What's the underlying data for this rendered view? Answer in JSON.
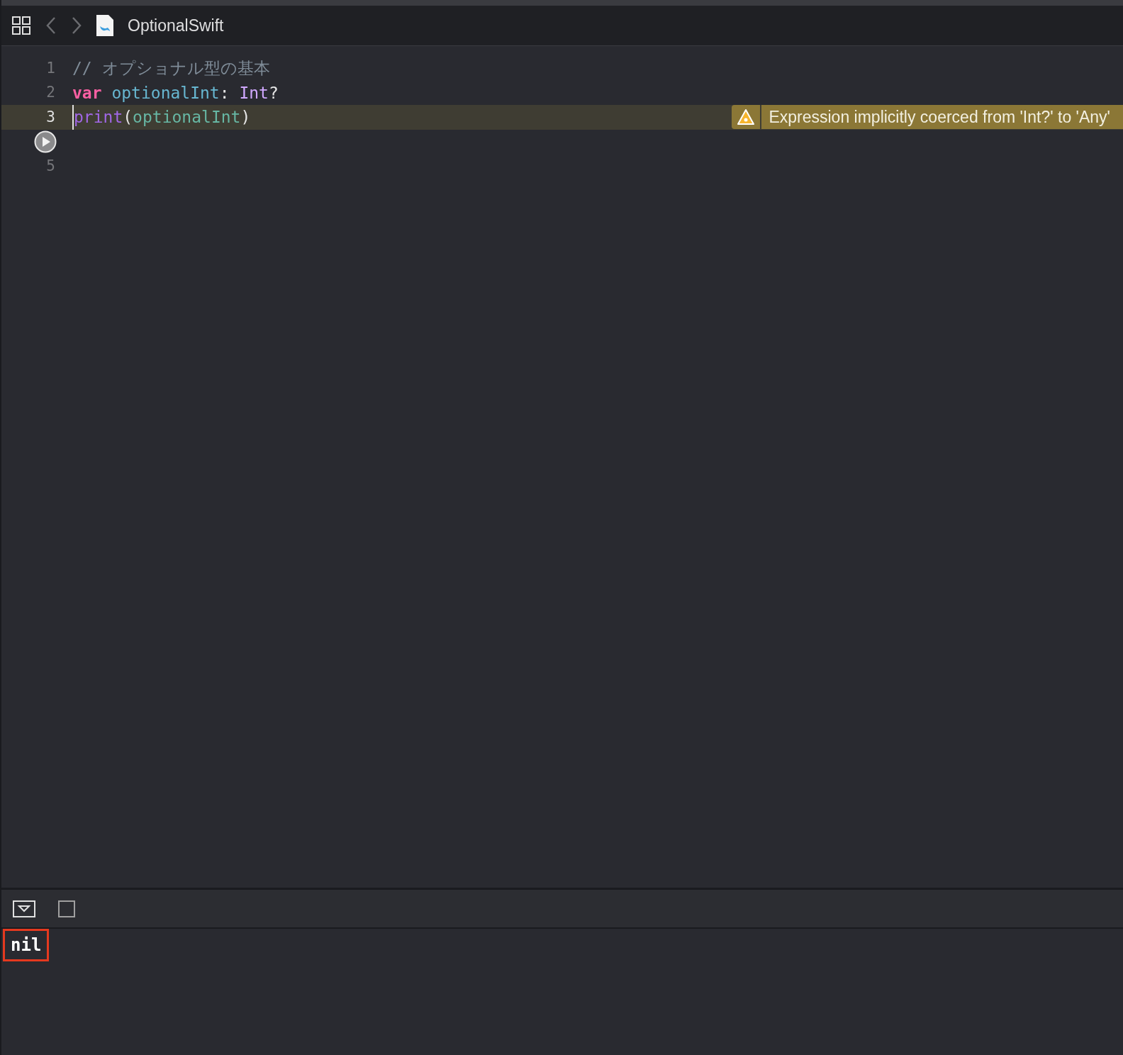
{
  "toolbar": {
    "file_name": "OptionalSwift"
  },
  "editor": {
    "lines": [
      {
        "kind": "code",
        "number": "1",
        "tokens": [
          {
            "kind": "comment",
            "text": "// オプショナル型の基本"
          }
        ]
      },
      {
        "kind": "code",
        "number": "2",
        "tokens": [
          {
            "kind": "keyword",
            "text": "var "
          },
          {
            "kind": "identifier",
            "text": "optionalInt"
          },
          {
            "kind": "plain",
            "text": ": "
          },
          {
            "kind": "type",
            "text": "Int"
          },
          {
            "kind": "plain",
            "text": "?"
          }
        ]
      },
      {
        "kind": "code",
        "number": "3",
        "current": true,
        "tokens": [
          {
            "kind": "function",
            "text": "print"
          },
          {
            "kind": "plain",
            "text": "("
          },
          {
            "kind": "variable",
            "text": "optionalInt"
          },
          {
            "kind": "plain",
            "text": ")"
          }
        ],
        "warning": "Expression implicitly coerced from 'Int?' to 'Any'"
      },
      {
        "kind": "run"
      },
      {
        "kind": "code",
        "number": "5"
      }
    ]
  },
  "console": {
    "output": "nil",
    "highlighted": true
  }
}
